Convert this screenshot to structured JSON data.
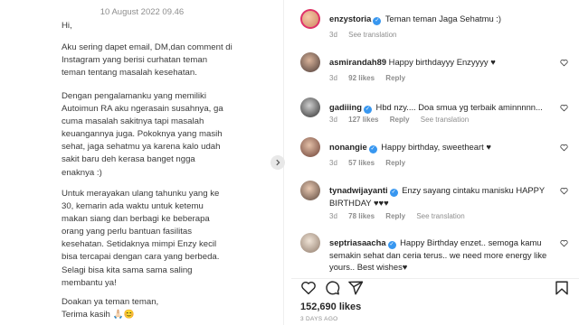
{
  "post": {
    "date": "10 August 2022 09.46",
    "greeting": "Hi,",
    "para1": "Aku sering dapet email, DM,dan comment di\nInstagram yang berisi curhatan teman\nteman tentang masalah kesehatan.",
    "para2": "Dengan pengalamanku yang memiliki\nAutoimun RA aku ngerasain susahnya, ga\ncuma masalah sakitnya tapi masalah\nkeuangannya juga. Pokoknya yang masih\nsehat, jaga sehatmu ya karena kalo udah\nsakit baru deh kerasa banget ngga\nenaknya :)",
    "para3": "Untuk merayakan ulang tahunku yang ke\n30, kemarin ada waktu untuk ketemu\nmakan siang dan berbagi ke beberapa\norang yang perlu bantuan fasilitas\nkesehatan. Setidaknya mimpi Enzy kecil\nbisa tercapai dengan cara yang berbeda.\nSelagi bisa kita sama sama saling\nmembantu ya!",
    "para4": "Doakan ya teman teman,\nTerima kasih 🙏🏻😊"
  },
  "caption": {
    "user": "enzystoria",
    "text": "Teman teman Jaga Sehatmu :)",
    "time": "3d",
    "translate": "See translation"
  },
  "comments": [
    {
      "user": "asmirandah89",
      "text": "Happy birthdayyy Enzyyyy ♥",
      "time": "3d",
      "likes": "92 likes",
      "reply": "Reply",
      "translate": ""
    },
    {
      "user": "gadiiing",
      "text": "Hbd nzy.... Doa smua yg terbaik aminnnnn...",
      "time": "3d",
      "likes": "127 likes",
      "reply": "Reply",
      "translate": "See translation"
    },
    {
      "user": "nonangie",
      "text": "Happy birthday, sweetheart ♥",
      "time": "3d",
      "likes": "57 likes",
      "reply": "Reply",
      "translate": ""
    },
    {
      "user": "tynadwijayanti",
      "text": "Enzy sayang cintaku manisku HAPPY BIRTHDAY ♥♥♥",
      "time": "3d",
      "likes": "78 likes",
      "reply": "Reply",
      "translate": "See translation"
    },
    {
      "user": "septriasaacha",
      "text": "Happy Birthday enzet.. semoga kamu semakin sehat dan ceria terus.. we need more energy like yours.. Best wishes♥",
      "time": "",
      "likes": "",
      "reply": "",
      "translate": ""
    }
  ],
  "likes_count": "152,690 likes",
  "posted_ago": "3 DAYS AGO",
  "icons": [
    "heart-icon",
    "comment-icon",
    "share-icon",
    "bookmark-icon",
    "chevron-right-icon",
    "verified-icon"
  ]
}
